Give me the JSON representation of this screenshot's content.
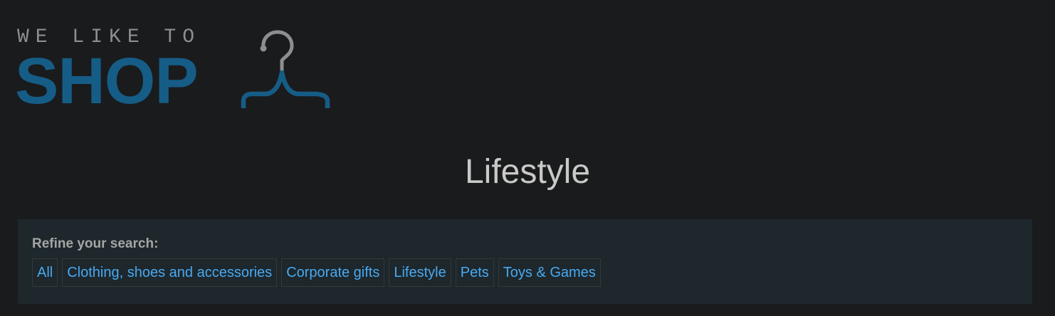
{
  "brand": {
    "tagline": "WE LIKE TO",
    "wordmark": "SHOP",
    "colors": {
      "wordmark": "#155d86",
      "tagline": "#8d8e90",
      "hanger_hook": "#8d8e90",
      "hanger_bar": "#155d86"
    },
    "icon": "hanger-icon"
  },
  "page": {
    "title": "Lifestyle"
  },
  "refine": {
    "label": "Refine your search:",
    "filters": [
      {
        "label": "All"
      },
      {
        "label": "Clothing, shoes and accessories"
      },
      {
        "label": "Corporate gifts"
      },
      {
        "label": "Lifestyle"
      },
      {
        "label": "Pets"
      },
      {
        "label": "Toys & Games"
      }
    ]
  },
  "theme": {
    "background": "#1a1b1d",
    "panel": "#1d272c",
    "link": "#4aa9f0"
  }
}
